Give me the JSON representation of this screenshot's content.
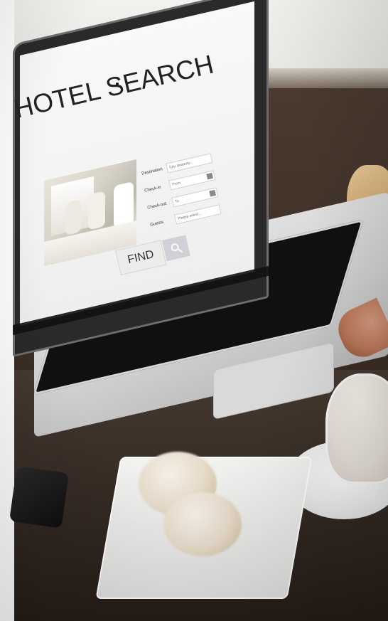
{
  "photo": {
    "laptop_screen": {
      "title": "HOTEL SEARCH",
      "fields": [
        {
          "label": "Destination",
          "value": "City, property..."
        },
        {
          "label": "Check-in",
          "value": "From"
        },
        {
          "label": "Check-out",
          "value": "To"
        },
        {
          "label": "Guests",
          "value": "Please select..."
        }
      ],
      "find_button": "FIND",
      "icons": {
        "search": "search-icon",
        "calendar": "calendar-icon"
      }
    }
  }
}
